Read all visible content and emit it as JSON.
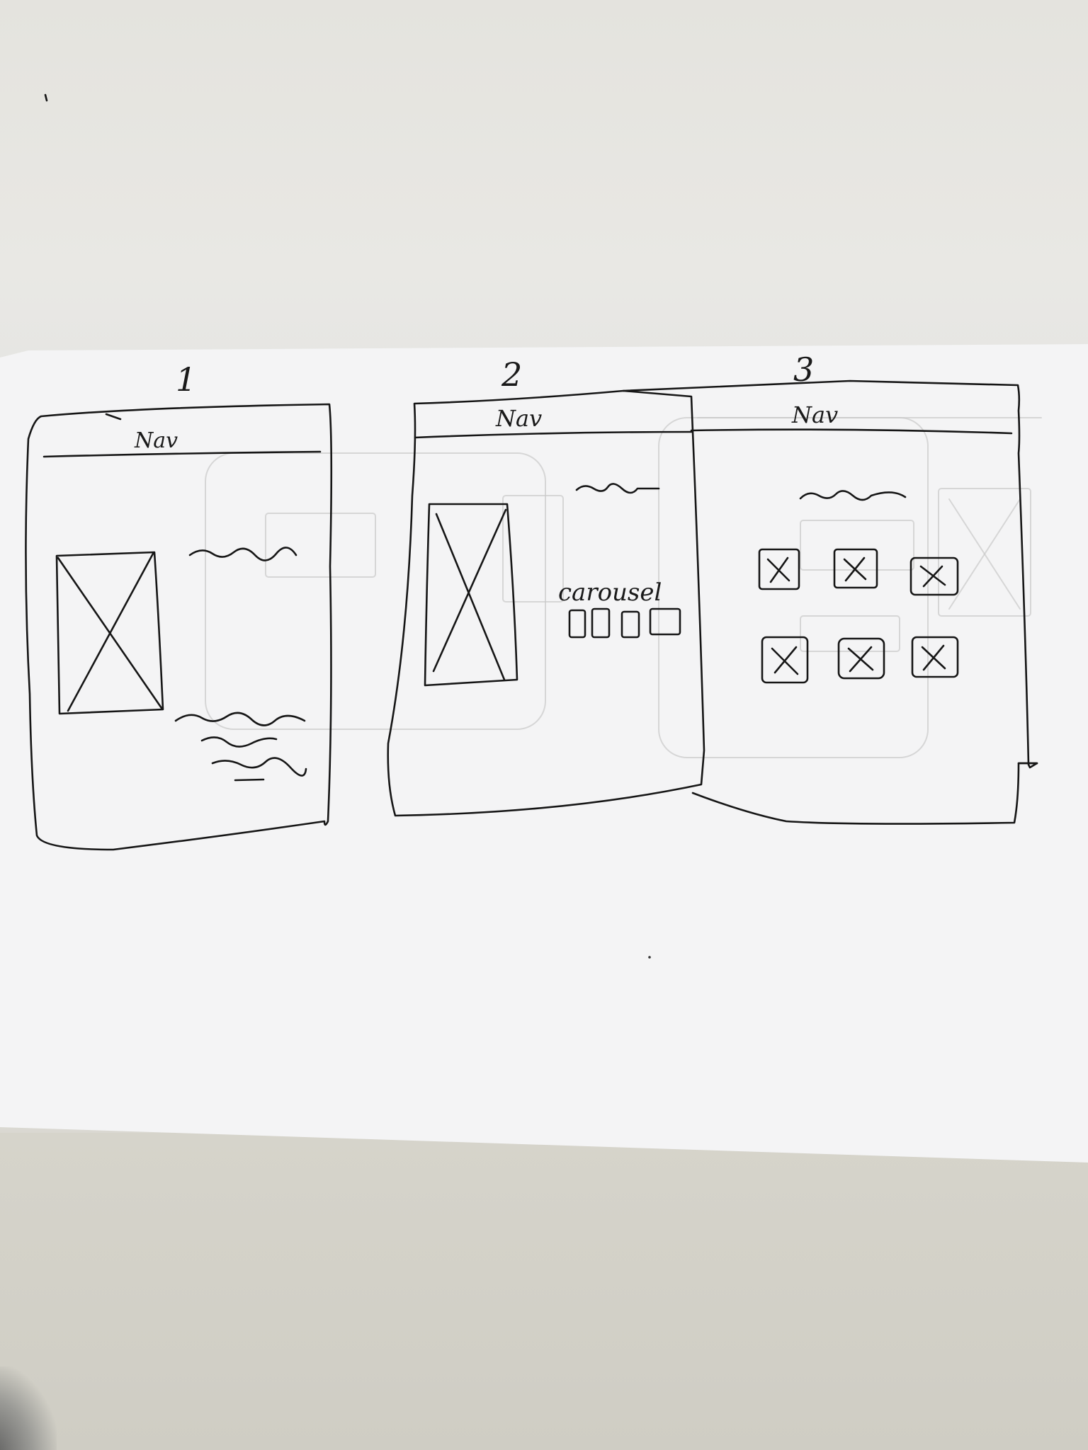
{
  "wireframes": [
    {
      "number": "1",
      "nav_label": "Nav"
    },
    {
      "number": "2",
      "nav_label": "Nav",
      "carousel_label": "carousel"
    },
    {
      "number": "3",
      "nav_label": "Nav"
    }
  ]
}
